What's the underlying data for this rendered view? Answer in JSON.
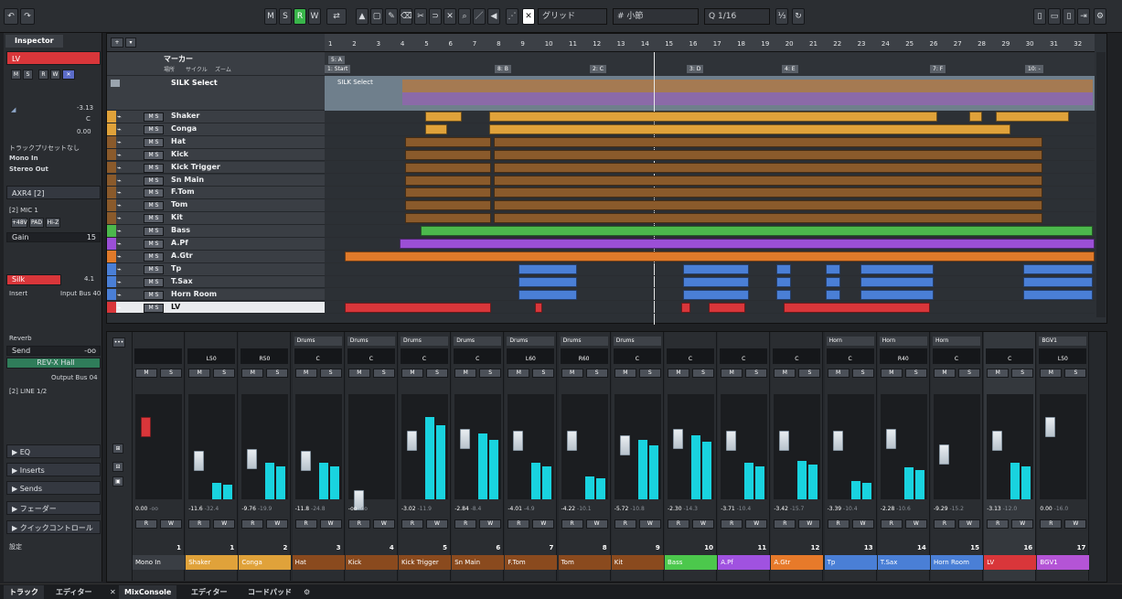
{
  "toolbar": {
    "m_label": "M",
    "s_label": "S",
    "r_label": "R",
    "w_label": "W",
    "grid_type": "グリッド",
    "grid_value": "小節",
    "quantize": "1/16"
  },
  "inspector": {
    "tab": "Inspector",
    "track_name": "LV",
    "volume_value": "-3.13",
    "pan_value": "C",
    "delay_value": "0.00",
    "preset_label": "トラックプリセットなし",
    "input": "Mono In",
    "output": "Stereo Out",
    "insert_name": "AXR4 [2]",
    "mic_label": "[2] MIC 1",
    "btn_48v": "+48V",
    "btn_pad": "PAD",
    "btn_hiz": "Hi-Z",
    "gain_label": "Gain",
    "gain_value": "15",
    "silk_label": "Silk",
    "silk_value": "4.1",
    "insert_label": "Insert",
    "insert_bus": "Input Bus 40",
    "reverb_label": "Reverb",
    "send_label": "Send",
    "send_value": "-oo",
    "rev_name": "REV-X Hall",
    "output_bus": "Output Bus 04",
    "line_label": "[2] LINE 1/2",
    "sections": [
      "EQ",
      "Inserts",
      "Sends",
      "フェーダー",
      "クイックコントロール",
      "設定"
    ]
  },
  "project": {
    "marker_label": "マーカー",
    "marker_sub": [
      "場所",
      "サイクル",
      "ズーム"
    ],
    "folder_name": "SILK Select",
    "bars": [
      "1",
      "2",
      "3",
      "4",
      "5",
      "6",
      "7",
      "8",
      "9",
      "10",
      "11",
      "12",
      "13",
      "14",
      "15",
      "16",
      "17",
      "18",
      "19",
      "20",
      "21",
      "22",
      "23",
      "24",
      "25",
      "26",
      "27",
      "28",
      "29",
      "30",
      "31",
      "32"
    ],
    "markers": [
      "5: A",
      "1: Start",
      "8: B",
      "2: C",
      "3: D",
      "4: E",
      "7: F",
      "10: -"
    ],
    "tracks": [
      {
        "num": "1",
        "name": "Shaker",
        "color": "#e0a23a"
      },
      {
        "num": "2",
        "name": "Conga",
        "color": "#e0a23a"
      },
      {
        "num": "3",
        "name": "Hat",
        "color": "#8a5a2b"
      },
      {
        "num": "4",
        "name": "Kick",
        "color": "#8a5a2b"
      },
      {
        "num": "5",
        "name": "Kick Trigger",
        "color": "#8a5a2b"
      },
      {
        "num": "6",
        "name": "Sn Main",
        "color": "#8a5a2b"
      },
      {
        "num": "7",
        "name": "F.Tom",
        "color": "#8a5a2b"
      },
      {
        "num": "8",
        "name": "Tom",
        "color": "#8a5a2b"
      },
      {
        "num": "9",
        "name": "Kit",
        "color": "#8a5a2b"
      },
      {
        "num": "10",
        "name": "Bass",
        "color": "#4cb84c"
      },
      {
        "num": "11",
        "name": "A.Pf",
        "color": "#9b4fd6"
      },
      {
        "num": "12",
        "name": "A.Gtr",
        "color": "#e07a2a"
      },
      {
        "num": "13",
        "name": "Tp",
        "color": "#4a7fd6"
      },
      {
        "num": "14",
        "name": "T.Sax",
        "color": "#4a7fd6"
      },
      {
        "num": "15",
        "name": "Horn Room",
        "color": "#4a7fd6"
      },
      {
        "num": "16",
        "name": "LV",
        "color": "#d9363a"
      }
    ]
  },
  "mixer": {
    "channels": [
      {
        "name": "Mono In",
        "num": "1",
        "group": "",
        "pan": "",
        "vol": "0.00",
        "peak": "-oo",
        "color": "#3a3e44"
      },
      {
        "name": "Shaker",
        "num": "1",
        "group": "",
        "pan": "L50",
        "vol": "-11.6",
        "peak": "-32.4",
        "color": "#e0a23a"
      },
      {
        "name": "Conga",
        "num": "2",
        "group": "",
        "pan": "R50",
        "vol": "-9.76",
        "peak": "-19.9",
        "color": "#e0a23a"
      },
      {
        "name": "Hat",
        "num": "3",
        "group": "Drums",
        "pan": "C",
        "vol": "-11.8",
        "peak": "-24.8",
        "color": "#8a4a1e"
      },
      {
        "name": "Kick",
        "num": "4",
        "group": "Drums",
        "pan": "C",
        "vol": "-oo",
        "peak": "-oo",
        "color": "#8a4a1e"
      },
      {
        "name": "Kick Trigger",
        "num": "5",
        "group": "Drums",
        "pan": "C",
        "vol": "-3.02",
        "peak": "-11.9",
        "color": "#8a4a1e"
      },
      {
        "name": "Sn Main",
        "num": "6",
        "group": "Drums",
        "pan": "C",
        "vol": "-2.84",
        "peak": "-8.4",
        "color": "#8a4a1e"
      },
      {
        "name": "F.Tom",
        "num": "7",
        "group": "Drums",
        "pan": "L60",
        "vol": "-4.01",
        "peak": "-4.9",
        "color": "#8a4a1e"
      },
      {
        "name": "Tom",
        "num": "8",
        "group": "Drums",
        "pan": "R60",
        "vol": "-4.22",
        "peak": "-10.1",
        "color": "#8a4a1e"
      },
      {
        "name": "Kit",
        "num": "9",
        "group": "Drums",
        "pan": "C",
        "vol": "-5.72",
        "peak": "-10.8",
        "color": "#8a4a1e"
      },
      {
        "name": "Bass",
        "num": "10",
        "group": "",
        "pan": "C",
        "vol": "-2.30",
        "peak": "-14.3",
        "color": "#4cc84c"
      },
      {
        "name": "A.Pf",
        "num": "11",
        "group": "",
        "pan": "C",
        "vol": "-3.71",
        "peak": "-10.4",
        "color": "#a052e0"
      },
      {
        "name": "A.Gtr",
        "num": "12",
        "group": "",
        "pan": "C",
        "vol": "-3.42",
        "peak": "-15.7",
        "color": "#e77a2a"
      },
      {
        "name": "Tp",
        "num": "13",
        "group": "Horn",
        "pan": "C",
        "vol": "-3.39",
        "peak": "-10.4",
        "color": "#4a7fd6"
      },
      {
        "name": "T.Sax",
        "num": "14",
        "group": "Horn",
        "pan": "R40",
        "vol": "-2.28",
        "peak": "-10.6",
        "color": "#4a7fd6"
      },
      {
        "name": "Horn Room",
        "num": "15",
        "group": "Horn",
        "pan": "C",
        "vol": "-9.29",
        "peak": "-15.2",
        "color": "#4a7fd6"
      },
      {
        "name": "LV",
        "num": "16",
        "group": "",
        "pan": "C",
        "vol": "-3.13",
        "peak": "-12.0",
        "color": "#d9363a"
      },
      {
        "name": "BGV1",
        "num": "17",
        "group": "BGV1",
        "pan": "L50",
        "vol": "0.00",
        "peak": "-16.0",
        "color": "#b454d6"
      }
    ]
  },
  "bottom_tabs": [
    "トラック",
    "エディター",
    "MixConsole",
    "エディター",
    "コードパッド"
  ]
}
